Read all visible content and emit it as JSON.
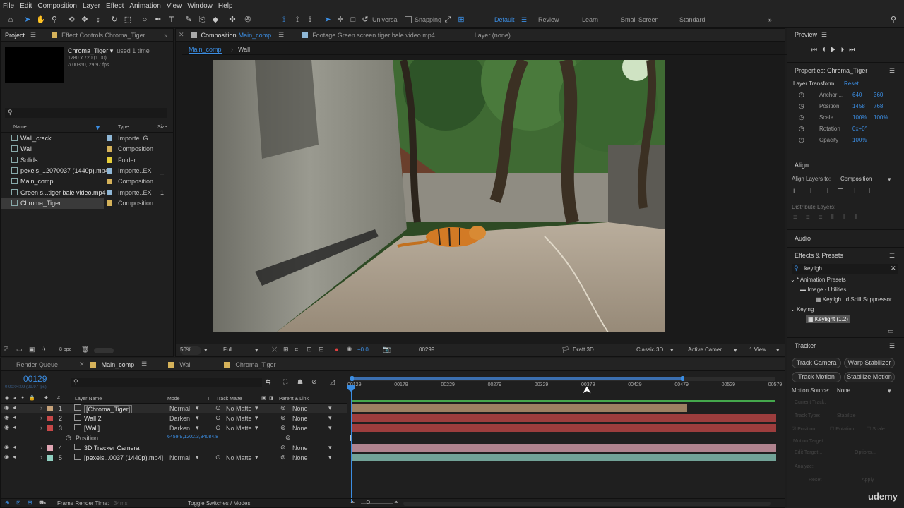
{
  "menu": [
    "File",
    "Edit",
    "Composition",
    "Layer",
    "Effect",
    "Animation",
    "View",
    "Window",
    "Help"
  ],
  "toolbar": {
    "universal": "Universal",
    "snapping": "Snapping",
    "workspaces": [
      "Default",
      "Review",
      "Learn",
      "Small Screen",
      "Standard"
    ]
  },
  "project": {
    "tab": "Project",
    "effect_tab": "Effect Controls Chroma_Tiger",
    "item_name": "Chroma_Tiger",
    "used": ", used 1 time",
    "dims": "1280 x 720 (1.00)",
    "duration": "Δ 00360, 29.97 fps",
    "col_name": "Name",
    "col_type": "Type",
    "col_size": "Size",
    "items": [
      {
        "name": "Wall_crack",
        "type": "Importe..G",
        "color": "#8fb7d6",
        "size": ""
      },
      {
        "name": "Wall",
        "type": "Composition",
        "color": "#d5b25a",
        "size": ""
      },
      {
        "name": "Solids",
        "type": "Folder",
        "color": "#e6cf3a",
        "size": ""
      },
      {
        "name": "pexels_..2070037 (1440p).mp4",
        "type": "Importe..EX",
        "color": "#8fb7d6",
        "size": "_"
      },
      {
        "name": "Main_comp",
        "type": "Composition",
        "color": "#d5b25a",
        "size": ""
      },
      {
        "name": "Green s...tiger bale video.mp4",
        "type": "Importe..EX",
        "color": "#8fb7d6",
        "size": "1"
      },
      {
        "name": "Chroma_Tiger",
        "type": "Composition",
        "color": "#d5b25a",
        "size": ""
      }
    ],
    "bpc": "8 bpc"
  },
  "viewer": {
    "comp_tab": "Composition",
    "comp_name": "Main_comp",
    "footage_tab": "Footage  Green screen tiger bale video.mp4",
    "layer_tab": "Layer  (none)",
    "crumb1": "Main_comp",
    "crumb2": "Wall",
    "zoom": "50%",
    "res": "Full",
    "exposure": "+0.0",
    "timecode": "00299",
    "renderer": "Draft 3D",
    "renderer2": "Classic 3D",
    "camera": "Active Camer...",
    "views": "1 View"
  },
  "timeline": {
    "tabs": [
      "Render Queue",
      "Main_comp",
      "Wall",
      "Chroma_Tiger"
    ],
    "timecode": "00129",
    "fps": "0:00:04:09 (29.97 fps)",
    "h_layer": "Layer Name",
    "h_mode": "Mode",
    "h_t": "T",
    "h_matte": "Track Matte",
    "h_parent": "Parent & Link",
    "ruler": [
      "00129",
      "00179",
      "00229",
      "00279",
      "00329",
      "00379",
      "00429",
      "00479",
      "00529",
      "00579"
    ],
    "layers": [
      {
        "num": "1",
        "name": "[Chroma_Tiger]",
        "mode": "Normal",
        "matte": "No Matte",
        "parent": "None",
        "color": "#c7a27a"
      },
      {
        "num": "2",
        "name": "Wall 2",
        "mode": "Darken",
        "matte": "No Matte",
        "parent": "None",
        "color": "#c74848"
      },
      {
        "num": "3",
        "name": "[Wall]",
        "mode": "Darken",
        "matte": "No Matte",
        "parent": "None",
        "color": "#c74848"
      },
      {
        "num": "4",
        "name": "3D Tracker Camera",
        "mode": "",
        "matte": "",
        "parent": "None",
        "color": "#e1a6b4"
      },
      {
        "num": "5",
        "name": "[pexels...0037 (1440p).mp4]",
        "mode": "Normal",
        "matte": "No Matte",
        "parent": "None",
        "color": "#8fcfc0"
      }
    ],
    "position_label": "Position",
    "position_value": "6459.9,1202.3,34084.8",
    "footer_left": "Frame Render Time:",
    "footer_ms": "34ms",
    "footer_toggle": "Toggle Switches / Modes"
  },
  "right": {
    "preview": "Preview",
    "properties": "Properties: Chroma_Tiger",
    "layer_transform": "Layer Transform",
    "reset": "Reset",
    "props": [
      {
        "label": "Anchor ...",
        "v1": "640",
        "v2": "360"
      },
      {
        "label": "Position",
        "v1": "1458",
        "v2": "768"
      },
      {
        "label": "Scale",
        "v1": "100%",
        "v2": "100%"
      },
      {
        "label": "Rotation",
        "v1": "0x+0°",
        "v2": ""
      },
      {
        "label": "Opacity",
        "v1": "100%",
        "v2": ""
      }
    ],
    "align": "Align",
    "align_to_label": "Align Layers to:",
    "align_to": "Composition",
    "distribute": "Distribute Layers:",
    "audio": "Audio",
    "effects": "Effects & Presets",
    "search": "keyligh",
    "tree": [
      "* Animation Presets",
      "Image - Utilities",
      "Keyligh...d Spill Suppressor",
      "Keying",
      "Keylight (1.2)"
    ],
    "tracker": "Tracker",
    "btn_track_camera": "Track Camera",
    "btn_warp": "Warp Stabilizer",
    "btn_track_motion": "Track Motion",
    "btn_stabilize": "Stabilize Motion",
    "motion_source_label": "Motion Source:",
    "motion_source": "None",
    "current_track": "Current Track:",
    "track_type": "Track Type:",
    "track_type_val": "Stabilize",
    "chk_position": "Position",
    "chk_rotation": "Rotation",
    "chk_scale": "Scale",
    "motion_target": "Motion Target:",
    "edit_target": "Edit Target...",
    "options": "Options...",
    "analyze": "Analyze:",
    "reset_btn": "Reset",
    "apply_btn": "Apply",
    "watermark": "udemy"
  }
}
